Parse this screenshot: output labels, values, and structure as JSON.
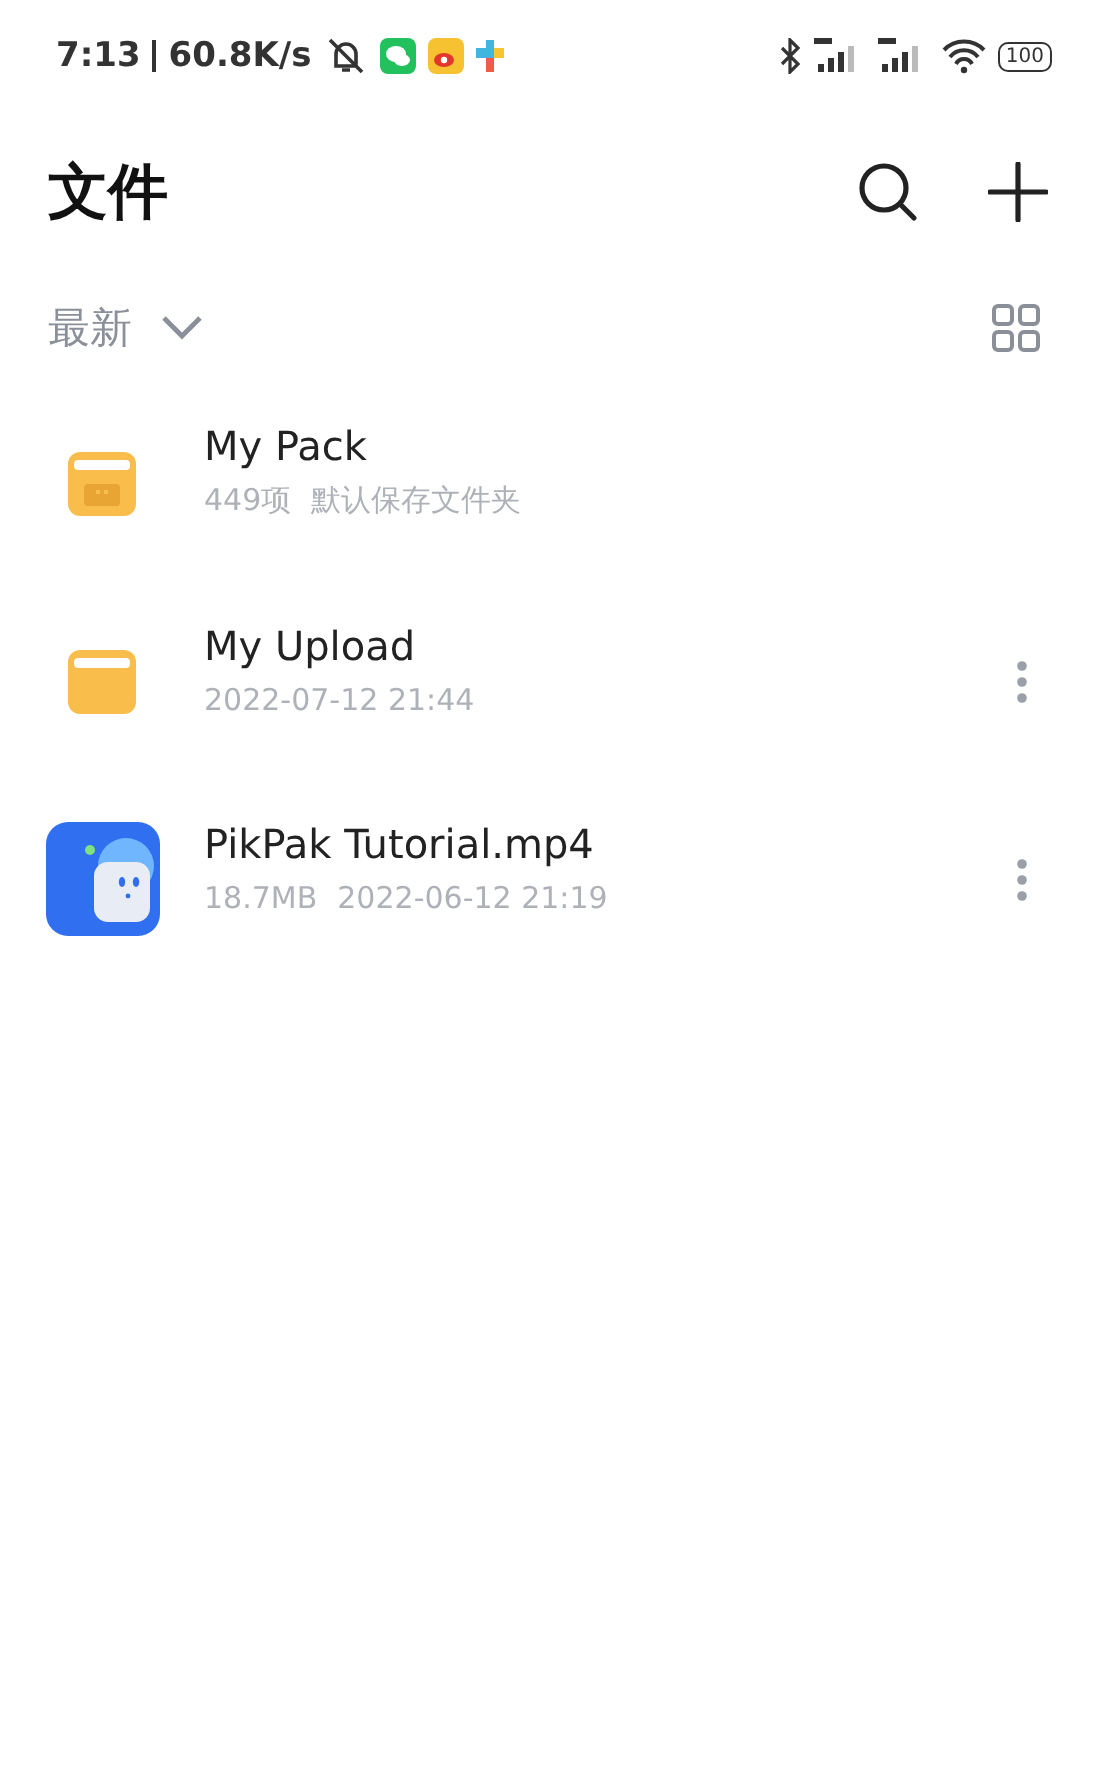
{
  "status_bar": {
    "time": "7:13",
    "speed": "60.8K/s",
    "battery": "100"
  },
  "header": {
    "title": "文件"
  },
  "sort": {
    "label": "最新"
  },
  "files": [
    {
      "kind": "pack",
      "name": "My Pack",
      "details": [
        "449项",
        "默认保存文件夹"
      ],
      "has_menu": false
    },
    {
      "kind": "folder",
      "name": "My Upload",
      "details": [
        "2022-07-12 21:44"
      ],
      "has_menu": true
    },
    {
      "kind": "video",
      "name": "PikPak Tutorial.mp4",
      "details": [
        "18.7MB",
        "2022-06-12 21:19"
      ],
      "has_menu": true
    }
  ]
}
